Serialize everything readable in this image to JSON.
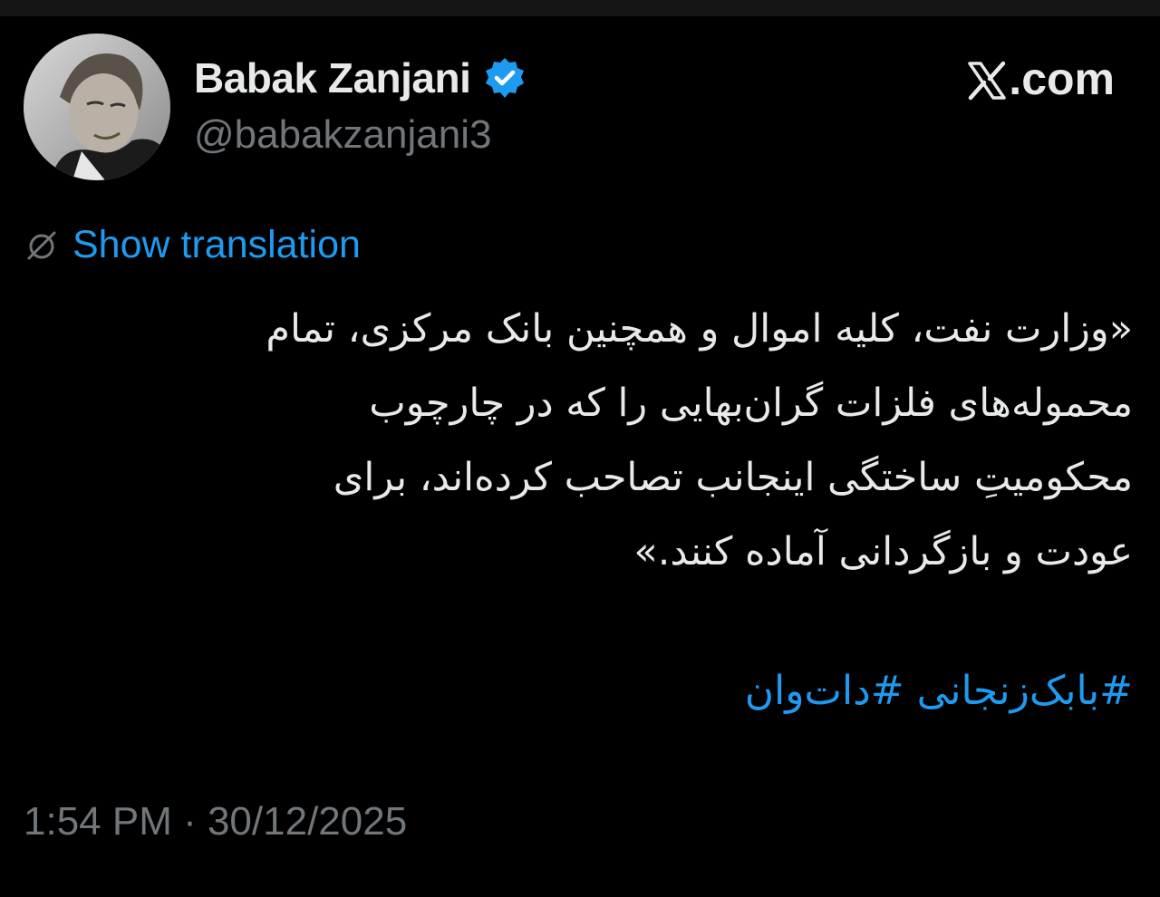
{
  "author": {
    "display_name": "Babak Zanjani",
    "handle": "@babakzanjani3",
    "verified": true,
    "avatar_icon": "profile-photo-icon"
  },
  "brand": {
    "label": ".com",
    "icon": "x-logo-icon"
  },
  "translation": {
    "label": "Show translation",
    "icon": "globe-slash-icon"
  },
  "tweet": {
    "lines": [
      "«وزارت نفت، کلیه اموال و همچنین بانک مرکزی، تمام",
      "محموله‌های فلزات گران‌بهایی را که در چارچوب",
      "محکومیتِ ساختگی اینجانب تصاحب کرده‌اند، برای",
      "عودت و بازگردانی آماده کنند.»"
    ],
    "hashtags": [
      "#بابک‌زنجانی",
      "#دات‌وان"
    ]
  },
  "timestamp": "1:54 PM · 30/12/2025",
  "colors": {
    "background": "#000000",
    "text": "#e7e9ea",
    "secondary": "#71767b",
    "accent": "#1d9bf0"
  }
}
